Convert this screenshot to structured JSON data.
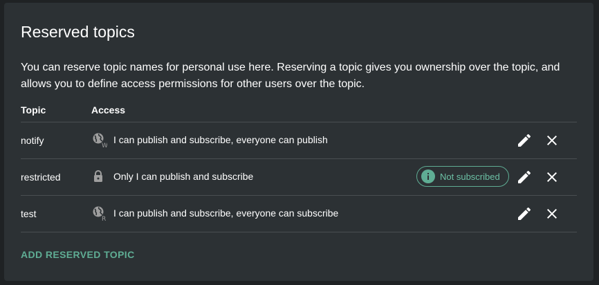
{
  "card": {
    "title": "Reserved topics",
    "description": "You can reserve topic names for personal use here. Reserving a topic gives you ownership over the topic, and allows you to define access permissions for other users over the topic."
  },
  "table": {
    "columns": [
      "Topic",
      "Access"
    ],
    "rows": [
      {
        "topic": "notify",
        "access_icon": "globe-write-icon",
        "access_badge": "W",
        "access": "I can publish and subscribe, everyone can publish"
      },
      {
        "topic": "restricted",
        "access_icon": "lock-icon",
        "access": "Only I can publish and subscribe",
        "chip": "Not subscribed"
      },
      {
        "topic": "test",
        "access_icon": "globe-read-icon",
        "access_badge": "R",
        "access": "I can publish and subscribe, everyone can subscribe"
      }
    ]
  },
  "actions": {
    "add_label": "ADD RESERVED TOPIC"
  },
  "colors": {
    "background": "#1f2224",
    "card": "#2c3134",
    "accent": "#5fad94",
    "icon": "#9e9e9e"
  }
}
